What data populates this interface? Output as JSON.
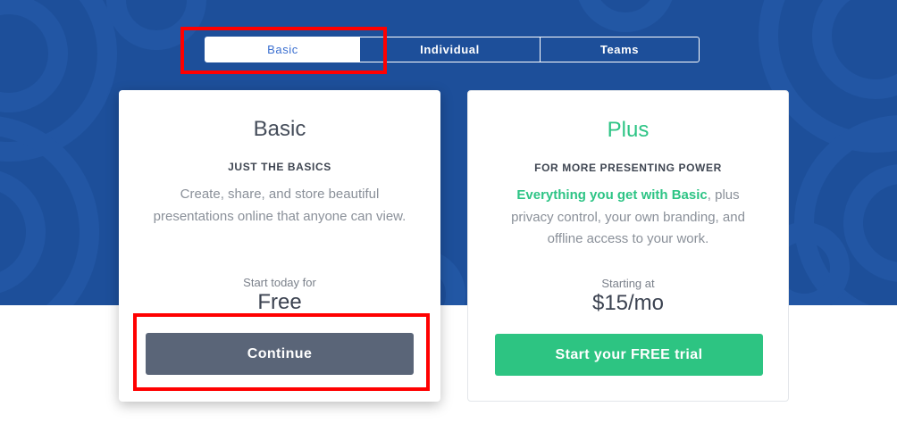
{
  "tabs": [
    {
      "label": "Basic",
      "active": true
    },
    {
      "label": "Individual",
      "active": false
    },
    {
      "label": "Teams",
      "active": false
    }
  ],
  "plans": {
    "basic": {
      "title": "Basic",
      "subtitle": "JUST THE BASICS",
      "description": "Create, share, and store beautiful presentations online that anyone can view.",
      "price_label": "Start today for",
      "price": "Free",
      "button_label": "Continue"
    },
    "plus": {
      "title": "Plus",
      "subtitle": "FOR MORE PRESENTING POWER",
      "description_highlight": "Everything you get with Basic",
      "description_rest": ", plus privacy control, your own branding, and offline access to your work.",
      "price_label": "Starting at",
      "price": "$15/mo",
      "button_label": "Start your FREE trial"
    }
  },
  "colors": {
    "hero_background": "#1d4f9a",
    "accent_green": "#2dc485",
    "continue_button": "#5a6578",
    "active_tab_text": "#3b6fd0",
    "highlight_box": "#ff0000"
  }
}
